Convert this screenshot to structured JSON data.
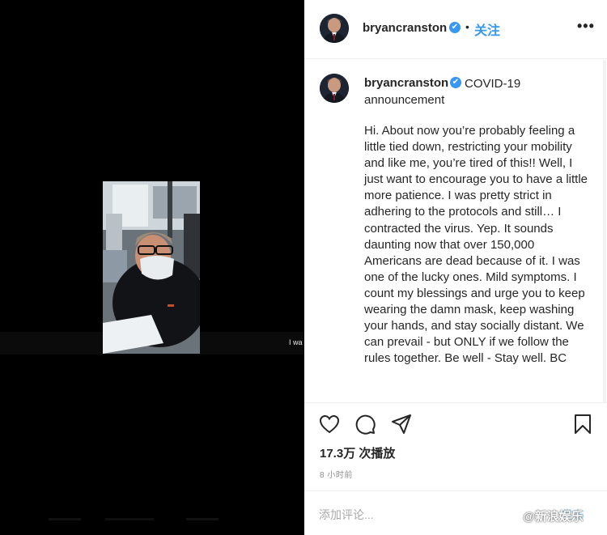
{
  "caption_overlay": "I wa",
  "header": {
    "username": "bryancranston",
    "verified_icon": "✔",
    "separator": "•",
    "follow_label": "关注",
    "more_label": "•••"
  },
  "post": {
    "username": "bryancranston",
    "verified_icon": "✔",
    "title": "COVID-19 announcement",
    "body": "Hi. About now you’re probably feeling a little tied down, restricting your mobility and like me, you’re tired of this!! Well, I just want to encourage you to have a little more patience. I was pretty strict in adhering to the protocols and still… I contracted the virus. Yep. It sounds daunting now that over 150,000 Americans are dead because of it. I was one of the lucky ones. Mild symptoms. I count my blessings and urge you to keep wearing the damn mask, keep washing your hands, and stay socially distant. We can prevail - but ONLY if we follow the rules together. Be well - Stay well. BC"
  },
  "actions": {
    "icons": [
      "heart-icon",
      "comment-icon",
      "share-icon",
      "bookmark-icon"
    ],
    "views": "17.3万 次播放",
    "time_ago": "8 小时前"
  },
  "comment": {
    "placeholder": "添加评论...",
    "post_label": "发布"
  },
  "watermark": {
    "text": "@新浪娱乐"
  },
  "colors": {
    "accent": "#3897f0",
    "text": "#262626",
    "muted": "#8e8e8e",
    "media_bg": "#000000"
  }
}
